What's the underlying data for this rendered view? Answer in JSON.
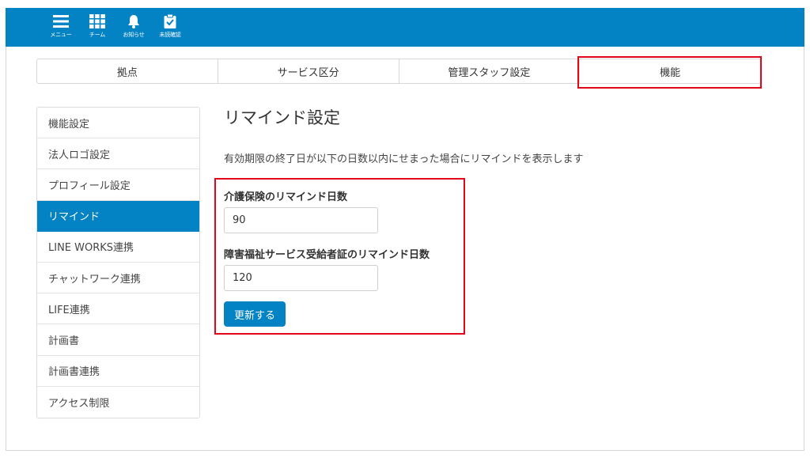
{
  "topnav": [
    {
      "label": "メニュー",
      "icon": "menu-icon"
    },
    {
      "label": "チーム",
      "icon": "grid-icon"
    },
    {
      "label": "お知らせ",
      "icon": "bell-icon"
    },
    {
      "label": "未読確認",
      "icon": "clipboard-check-icon"
    }
  ],
  "tabs": [
    {
      "label": "拠点"
    },
    {
      "label": "サービス区分"
    },
    {
      "label": "管理スタッフ設定"
    },
    {
      "label": "機能"
    }
  ],
  "sidebar": {
    "items": [
      {
        "label": "機能設定"
      },
      {
        "label": "法人ロゴ設定"
      },
      {
        "label": "プロフィール設定"
      },
      {
        "label": "リマインド",
        "active": true
      },
      {
        "label": "LINE WORKS連携"
      },
      {
        "label": "チャットワーク連携"
      },
      {
        "label": "LIFE連携"
      },
      {
        "label": "計画書"
      },
      {
        "label": "計画書連携"
      },
      {
        "label": "アクセス制限"
      }
    ]
  },
  "main": {
    "title": "リマインド設定",
    "description": "有効期限の終了日が以下の日数以内にせまった場合にリマインドを表示します",
    "fields": [
      {
        "label": "介護保険のリマインド日数",
        "value": "90"
      },
      {
        "label": "障害福祉サービス受給者証のリマインド日数",
        "value": "120"
      }
    ],
    "submit_label": "更新する"
  },
  "colors": {
    "primary": "#0383c4",
    "highlight": "#e3061b"
  }
}
